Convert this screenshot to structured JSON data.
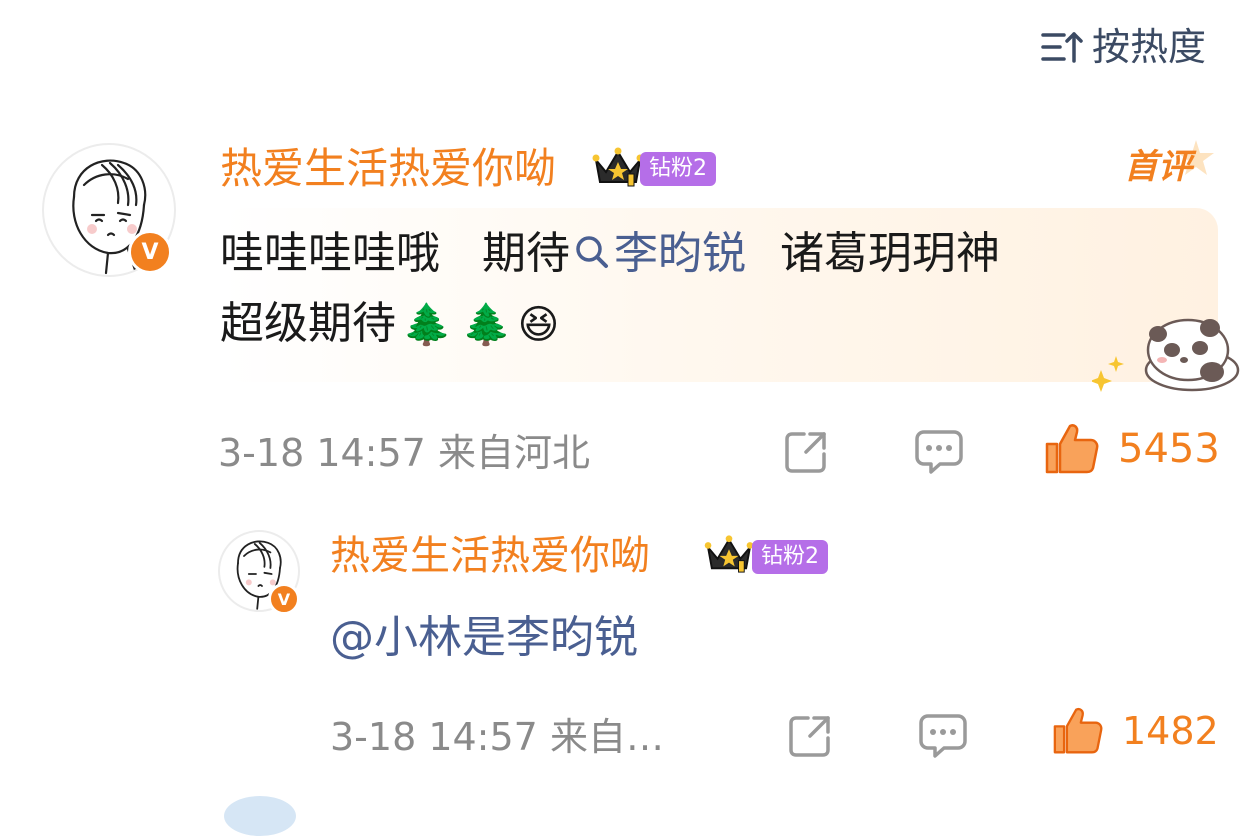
{
  "sort": {
    "label": "按热度"
  },
  "comment": {
    "username": "热爱生活热爱你呦",
    "fan_badge": "钻粉2",
    "tag": "首评",
    "verified_mark": "V",
    "text": {
      "part1": "哇哇哇哇哦   期待",
      "mention": "李昀锐",
      "part2": "诸葛玥玥神",
      "line2": "超级期待",
      "emoji": [
        "🌲",
        "🌲",
        "😆"
      ]
    },
    "timestamp": "3-18 14:57",
    "location": "来自河北",
    "likes": "5453"
  },
  "reply": {
    "username": "热爱生活热爱你呦",
    "fan_badge": "钻粉2",
    "verified_mark": "V",
    "text": "@小林是李昀锐",
    "timestamp": "3-18 14:57",
    "location": "来自…",
    "likes": "1482"
  },
  "icons": [
    "sort-icon",
    "share-icon",
    "comment-icon",
    "like-icon",
    "crown-icon",
    "search-icon",
    "panda-sticker"
  ],
  "colors": {
    "accent": "#f2801f",
    "badge": "#b56ee8",
    "link": "#4a5f91",
    "meta": "#8a8a8a"
  }
}
